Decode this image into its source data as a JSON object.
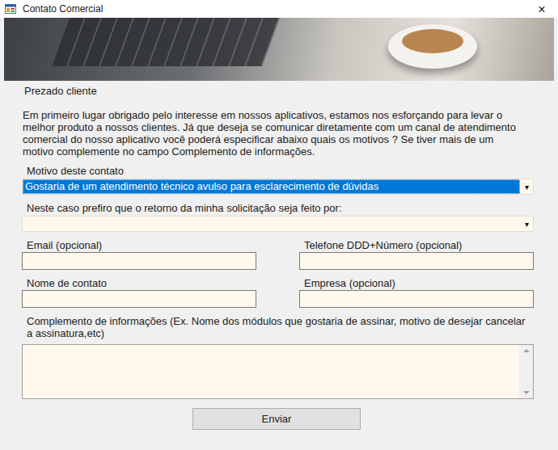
{
  "window": {
    "title": "Contato Comercial",
    "close": "×"
  },
  "greeting": "Prezado cliente",
  "intro": "Em primeiro lugar obrigado pelo interesse em nossos aplicativos, estamos nos esforçando para levar o melhor produto a nossos clientes. Já que deseja se comunicar diretamente com um canal de atendimento comercial do nosso aplicativo você poderá especificar abaixo quais os motivos ? Se tiver mais de um motivo complemente no campo Complemento de informações.",
  "reason": {
    "label": "Motivo deste contato",
    "value": "Gostaria de um atendimento técnico avulso para esclarecimento de dúvidas",
    "arrow": "▾",
    "selected": true
  },
  "reply_method": {
    "label": "Neste caso prefiro que o retorno da minha solicitação seja feito por:",
    "value": "",
    "arrow": "▾",
    "selected": false
  },
  "email": {
    "label": "Email (opcional)",
    "value": ""
  },
  "phone": {
    "label": "Telefone DDD+Número (opcional)",
    "value": ""
  },
  "contact_name": {
    "label": "Nome de contato",
    "value": ""
  },
  "company": {
    "label": "Empresa (opcional)",
    "value": ""
  },
  "details": {
    "label": "Complemento de informações (Ex. Nome dos módulos que gostaria de assinar, motivo de desejar cancelar a assinatura,etc)",
    "value": ""
  },
  "buttons": [
    "Enviar"
  ]
}
